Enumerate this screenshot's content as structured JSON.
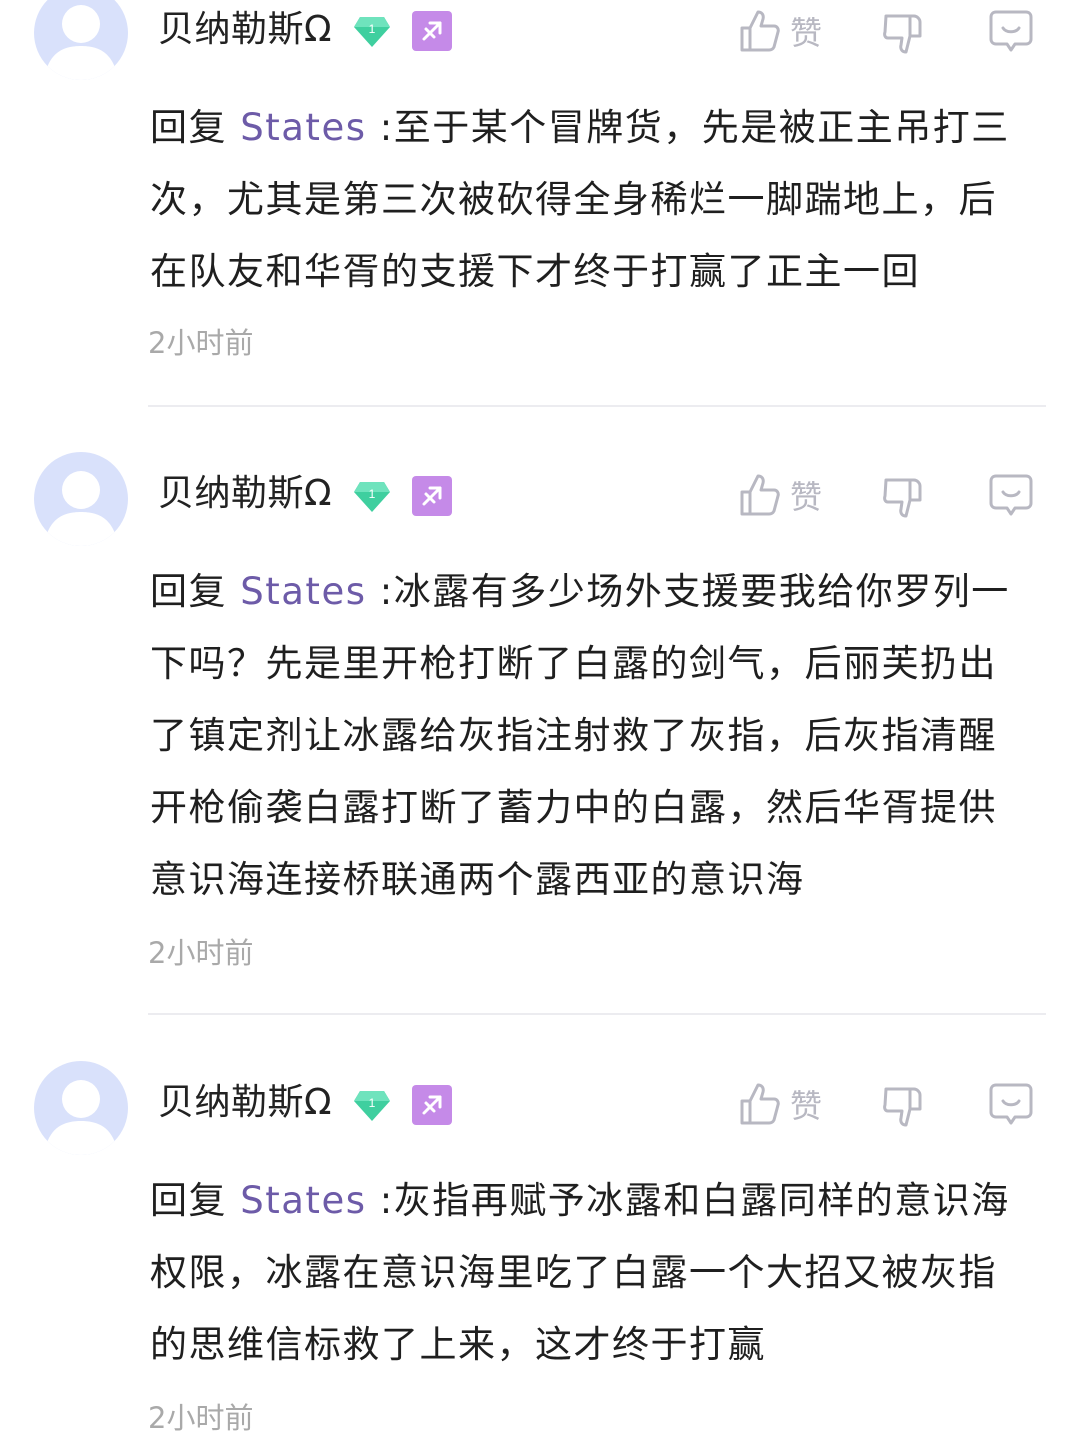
{
  "comments": [
    {
      "username": "贝纳勒斯Ω",
      "level_badge": "1",
      "like_label": "赞",
      "reply_prefix": "回复",
      "mention": "States",
      "separator": " :",
      "text": "至于某个冒牌货，先是被正主吊打三次，尤其是第三次被砍得全身稀烂一脚踹地上，后在队友和华胥的支援下才终于打赢了正主一回",
      "time": "2小时前"
    },
    {
      "username": "贝纳勒斯Ω",
      "level_badge": "1",
      "like_label": "赞",
      "reply_prefix": "回复",
      "mention": "States",
      "separator": " :",
      "text": "冰露有多少场外支援要我给你罗列一下吗？先是里开枪打断了白露的剑气，后丽芙扔出了镇定剂让冰露给灰指注射救了灰指，后灰指清醒开枪偷袭白露打断了蓄力中的白露，然后华胥提供意识海连接桥联通两个露西亚的意识海",
      "time": "2小时前"
    },
    {
      "username": "贝纳勒斯Ω",
      "level_badge": "1",
      "like_label": "赞",
      "reply_prefix": "回复",
      "mention": "States",
      "separator": " :",
      "text": "灰指再赋予冰露和白露同样的意识海权限，冰露在意识海里吃了白露一个大招又被灰指的思维信标救了上来，这才终于打赢",
      "time": "2小时前"
    }
  ],
  "colors": {
    "mention": "#6d5ba8",
    "time": "#a9a9a9",
    "icon": "#b8b8c2",
    "gem": "#3fcf9f",
    "zodiac": "#c58ae8",
    "avatar_bg": "#d9e1fb"
  },
  "icons": {
    "gem": "gem-level-icon",
    "zodiac": "sagittarius-icon",
    "like": "thumbs-up-icon",
    "dislike": "thumbs-down-icon",
    "reply": "comment-bubble-icon"
  }
}
